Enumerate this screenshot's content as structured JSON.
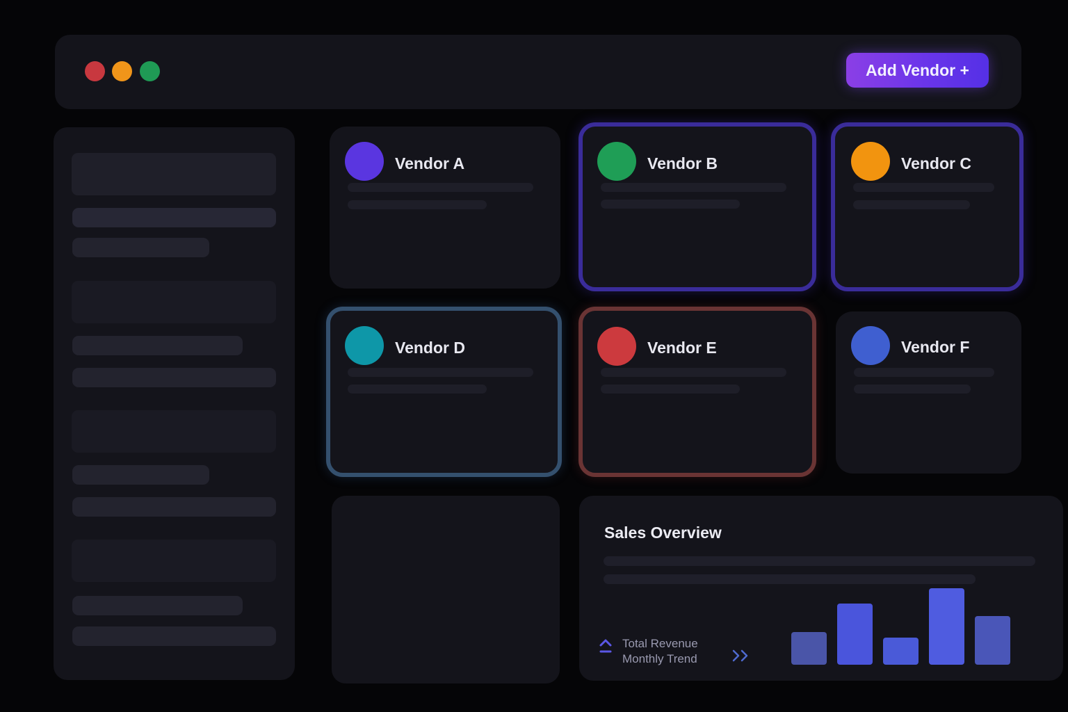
{
  "window": {
    "controls": [
      {
        "name": "close",
        "color": "#c8383f"
      },
      {
        "name": "minimize",
        "color": "#f0951a"
      },
      {
        "name": "maximize",
        "color": "#1f9a55"
      }
    ]
  },
  "toolbar": {
    "add_vendor_label": "Add Vendor +"
  },
  "vendors": [
    {
      "name": "Vendor A",
      "color": "#5a36e0",
      "outline": null
    },
    {
      "name": "Vendor B",
      "color": "#1f9e56",
      "outline": "#3a2c9a"
    },
    {
      "name": "Vendor C",
      "color": "#f2940f",
      "outline": "#3a2c9a"
    },
    {
      "name": "Vendor D",
      "color": "#0e97a8",
      "outline": "#34506e"
    },
    {
      "name": "Vendor E",
      "color": "#cc3a3e",
      "outline": "#6a3434"
    },
    {
      "name": "Vendor F",
      "color": "#3f5fd0",
      "outline": null
    }
  ],
  "sales_overview": {
    "title": "Sales Overview",
    "legend_line1": "Total Revenue",
    "legend_line2": "Monthly Trend",
    "accent": "#5b57e6"
  },
  "chart_data": {
    "type": "bar",
    "categories": [
      "",
      "",
      "",
      "",
      ""
    ],
    "values": [
      47,
      88,
      39,
      110,
      70
    ],
    "colors": [
      "#4a55a8",
      "#4a55dc",
      "#4a5ad8",
      "#4f5ce0",
      "#4a56b8"
    ],
    "title": "",
    "xlabel": "",
    "ylabel": "",
    "ylim": [
      0,
      110
    ],
    "grid": false
  }
}
